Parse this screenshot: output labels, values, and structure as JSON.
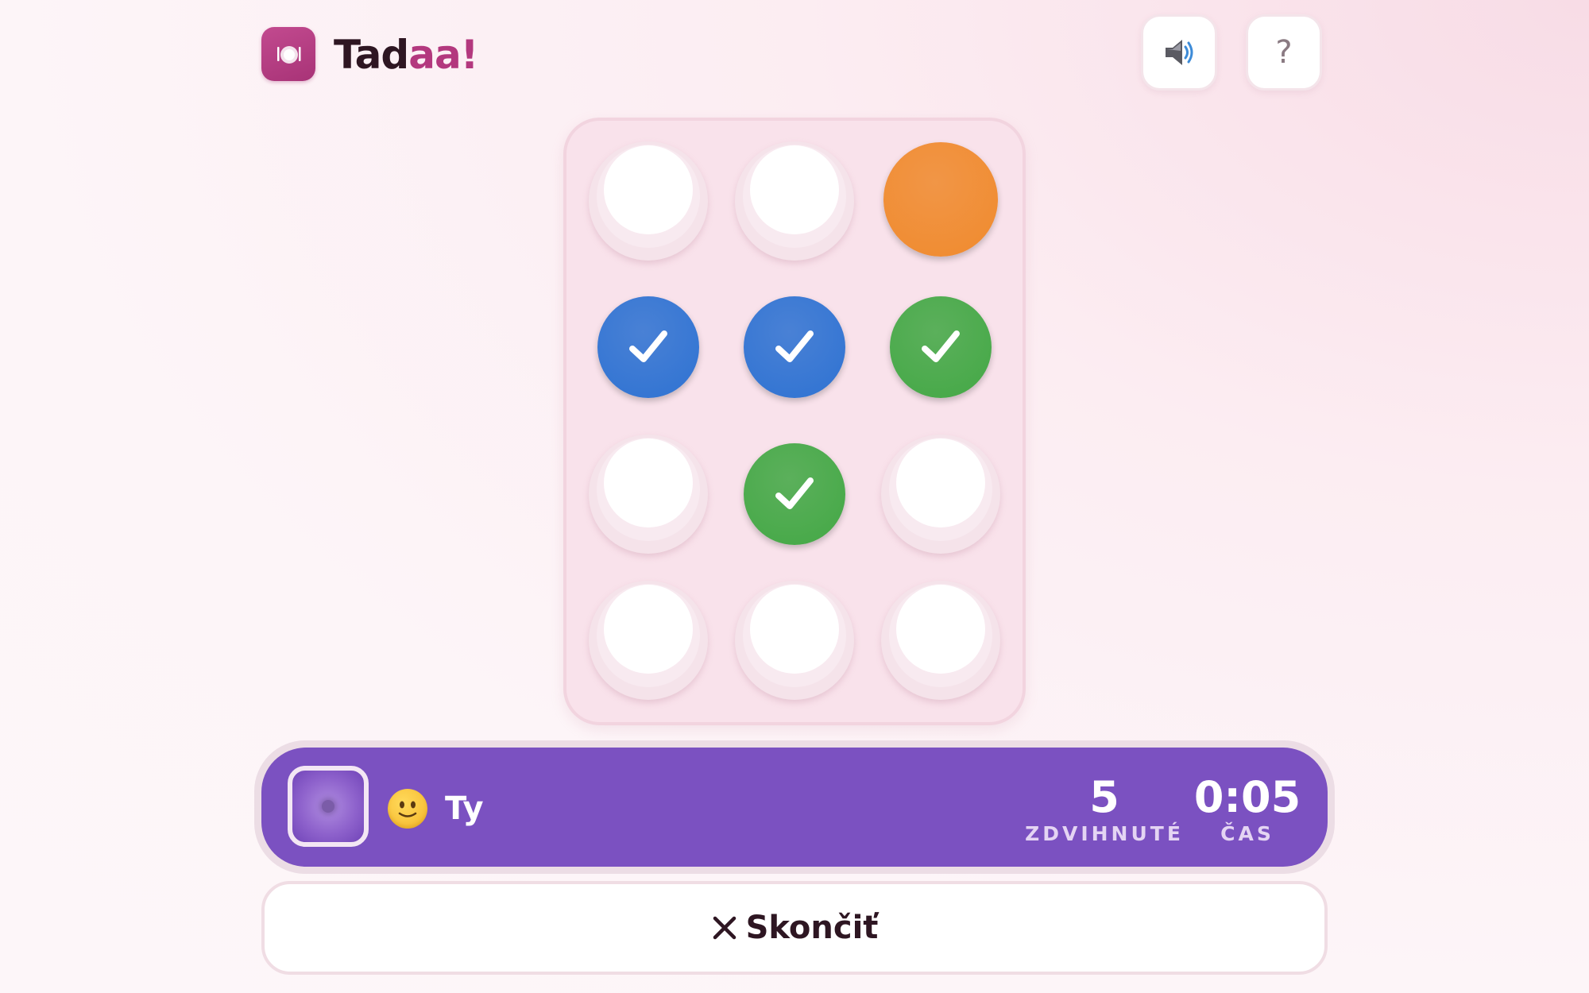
{
  "header": {
    "brand_part1": "Tad",
    "brand_part2": "aa!",
    "logo_icon": "plate-icon",
    "sound_icon": "speaker-icon",
    "help_label": "?"
  },
  "board": {
    "rows": 4,
    "cols": 3,
    "cells": [
      {
        "state": "empty"
      },
      {
        "state": "empty"
      },
      {
        "state": "lifted",
        "color": "#f08a2d"
      },
      {
        "state": "matched",
        "color": "#2e72d2"
      },
      {
        "state": "matched",
        "color": "#2e72d2"
      },
      {
        "state": "matched",
        "color": "#43a845"
      },
      {
        "state": "empty"
      },
      {
        "state": "matched",
        "color": "#43a845"
      },
      {
        "state": "empty"
      },
      {
        "state": "empty"
      },
      {
        "state": "empty"
      },
      {
        "state": "empty"
      }
    ]
  },
  "player": {
    "name": "Ty",
    "emoji_icon": "smiley-face-icon",
    "lifted_value": "5",
    "lifted_label": "ZDVIHNUTÉ",
    "time_value": "0:05",
    "time_label": "ČAS"
  },
  "actions": {
    "quit_label": "Skončiť"
  },
  "colors": {
    "brand": "#b3387e",
    "player_bar": "#7b51c1",
    "blue": "#2e72d2",
    "green": "#43a845",
    "orange": "#f08a2d"
  }
}
